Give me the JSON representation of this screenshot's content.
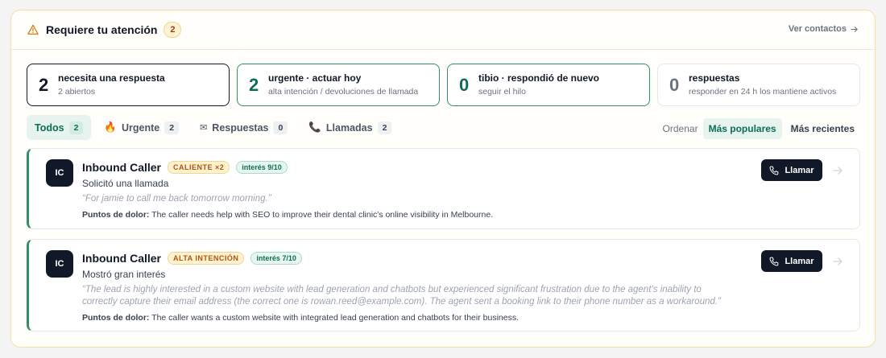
{
  "header": {
    "title": "Requiere tu atención",
    "count": "2",
    "link": "Ver contactos"
  },
  "stats": [
    {
      "value": "2",
      "title": "necesita una respuesta",
      "sub": "2 abiertos"
    },
    {
      "value": "2",
      "title": "urgente · actuar hoy",
      "sub": "alta intención / devoluciones de llamada"
    },
    {
      "value": "0",
      "title": "tibio · respondió de nuevo",
      "sub": "seguir el hilo"
    },
    {
      "value": "0",
      "title": "respuestas",
      "sub": "responder en 24 h los mantiene activos"
    }
  ],
  "tabs": [
    {
      "label": "Todos",
      "count": "2",
      "icon": ""
    },
    {
      "label": "Urgente",
      "count": "2",
      "icon": "🔥"
    },
    {
      "label": "Respuestas",
      "count": "0",
      "icon": "✉"
    },
    {
      "label": "Llamadas",
      "count": "2",
      "icon": "📞"
    }
  ],
  "sort": {
    "label": "Ordenar",
    "options": [
      "Más populares",
      "Más recientes"
    ],
    "active": "Más populares"
  },
  "cards": [
    {
      "initials": "IC",
      "name": "Inbound Caller",
      "tag": "CALIENTE ×2",
      "interest": "interés 9/10",
      "status": "Solicitó una llamada",
      "quote": "“For jamie to call me back tomorrow morning.”",
      "pain_label": "Puntos de dolor:",
      "pain": "The caller needs help with SEO to improve their dental clinic's online visibility in Melbourne.",
      "button": "Llamar"
    },
    {
      "initials": "IC",
      "name": "Inbound Caller",
      "tag": "ALTA INTENCIÓN",
      "interest": "interés 7/10",
      "status": "Mostró gran interés",
      "quote": "“The lead is highly interested in a custom website with lead generation and chatbots but experienced significant frustration due to the agent’s inability to correctly capture their email address (the correct one is rowan.reed@example.com). The agent sent a booking link to their phone number as a workaround.”",
      "pain_label": "Puntos de dolor:",
      "pain": "The caller wants a custom website with integrated lead generation and chatbots for their business.",
      "button": "Llamar"
    }
  ],
  "icons": {
    "warning": "warning-triangle-icon",
    "arrow": "arrow-right-icon",
    "phone": "phone-icon"
  },
  "colors": {
    "accent": "#0e6e55",
    "accent_border": "#2f8f68",
    "warn": "#d97706",
    "dark": "#111827"
  }
}
